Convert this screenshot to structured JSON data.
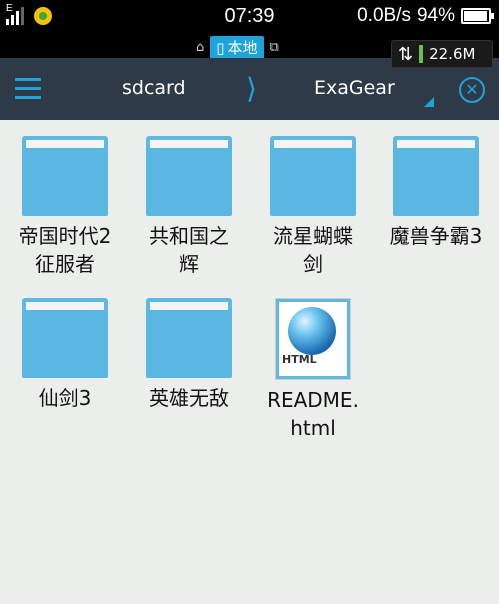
{
  "status_bar": {
    "network_type": "E",
    "time": "07:39",
    "speed": "0.0B/s",
    "battery": "94%",
    "battery_level": 0.94
  },
  "sub_bar": {
    "local_tab": "本地",
    "data_usage": "22.6M"
  },
  "toolbar": {
    "breadcrumbs": [
      "sdcard",
      "ExaGear"
    ],
    "accent": "#1fa3d8"
  },
  "files": [
    {
      "name": "帝国时代2征服者",
      "lines": [
        "帝国时代2",
        "征服者"
      ],
      "type": "folder"
    },
    {
      "name": "共和国之辉",
      "lines": [
        "共和国之",
        "辉"
      ],
      "type": "folder"
    },
    {
      "name": "流星蝴蝶剑",
      "lines": [
        "流星蝴蝶",
        "剑"
      ],
      "type": "folder"
    },
    {
      "name": "魔兽争霸3",
      "lines": [
        "魔兽争霸3"
      ],
      "type": "folder"
    },
    {
      "name": "仙剑3",
      "lines": [
        "仙剑3"
      ],
      "type": "folder"
    },
    {
      "name": "英雄无敌",
      "lines": [
        "英雄无敌"
      ],
      "type": "folder"
    },
    {
      "name": "README.html",
      "lines": [
        "README.",
        "html"
      ],
      "type": "html",
      "icon_text": "HTML"
    }
  ]
}
